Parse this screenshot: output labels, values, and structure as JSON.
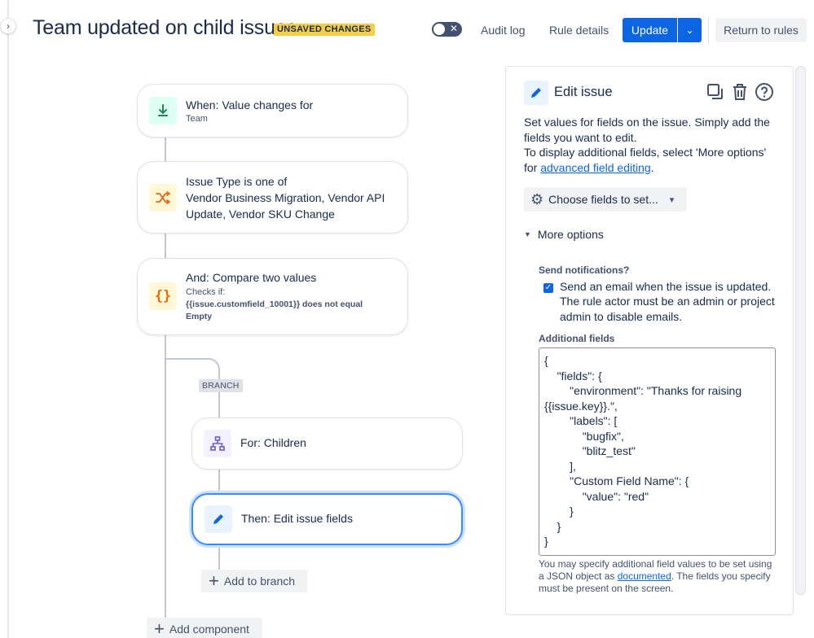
{
  "header": {
    "title": "Team updated on child issues",
    "badge": "UNSAVED CHANGES",
    "audit_log": "Audit log",
    "rule_details": "Rule details",
    "update": "Update",
    "return_to_rules": "Return to rules"
  },
  "flow": {
    "trigger": {
      "title": "When: Value changes for",
      "sub": "Team"
    },
    "condition1": {
      "title": "Issue Type is one of",
      "value": "Vendor Business Migration, Vendor API Update, Vendor SKU Change"
    },
    "condition2": {
      "title": "And: Compare two values",
      "sub": "Checks if:",
      "code": "{{issue.customfield_10001}} does not equal Empty"
    },
    "branch_label": "BRANCH",
    "branch": {
      "title": "For: Children"
    },
    "action": {
      "title": "Then: Edit issue fields"
    },
    "add_to_branch": "Add to branch",
    "add_component": "Add component"
  },
  "panel": {
    "title": "Edit issue",
    "desc_1": "Set values for fields on the issue. Simply add the fields you want to edit.",
    "desc_2": "To display additional fields, select 'More options' for ",
    "desc_link": "advanced field editing",
    "desc_end": ".",
    "choose_fields": "Choose fields to set...",
    "more_options": "More options",
    "notify_label": "Send notifications?",
    "notify_text": "Send an email when the issue is updated. The rule actor must be an admin or project admin to disable emails.",
    "additional_label": "Additional fields",
    "additional_json": "{\n    \"fields\": {\n        \"environment\": \"Thanks for raising {{issue.key}}.\",\n        \"labels\": [\n            \"bugfix\",\n            \"blitz_test\"\n        ],\n        \"Custom Field Name\": {\n            \"value\": \"red\"\n        }\n    }\n}",
    "help_1": "You may specify additional field values to be set using a JSON object as ",
    "help_link": "documented",
    "help_2": ". The fields you specify must be present on the screen."
  },
  "colors": {
    "primary": "#0c66e4",
    "badge": "#f5cd47",
    "trigger_icon_bg": "#dcfff1",
    "condition_icon_bg": "#fff7d6",
    "branch_icon_bg": "#f3f0ff"
  }
}
